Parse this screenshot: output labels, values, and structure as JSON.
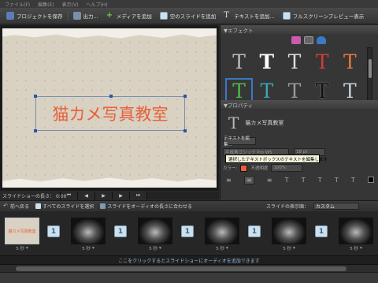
{
  "menubar": {
    "items": [
      "ファイル(F)",
      "編集(E)",
      "表示(V)",
      "ヘルプ(H)"
    ]
  },
  "toolbar": {
    "save_project": "プロジェクトを保存",
    "output": "出力...",
    "add_media": "メディアを追加",
    "add_blank_slide": "空のスライドを追加",
    "add_text": "テキストを追加...",
    "fullscreen_preview": "フルスクリーンプレビュー表示"
  },
  "preview": {
    "title_text": "猫カメ写真教室"
  },
  "transport": {
    "label": "スライドショーの長さ：",
    "time": "0:00"
  },
  "effects": {
    "header": "▼エフェクト"
  },
  "properties": {
    "header": "▼プロパティ",
    "text_name": "猫カメ写真教室",
    "edit_text_button": "テキストを編集...",
    "font": "平成角ゴシック Pro W5",
    "size": "18 pt",
    "color_label": "カラー:",
    "opacity": "不透明度",
    "opacity_value": "100%",
    "tooltip": "選択したテキストボックスのテキストを編集します"
  },
  "strip": {
    "back": "前へ戻る",
    "select_all": "すべてのスライドを選択",
    "fit_audio": "スライドをオーディオの長さに合わせる",
    "display_label": "スライドの表示順：",
    "display_value": "カスタム",
    "first_thumb_text": "猫カメ写真教室",
    "slot_label": "5 秒",
    "transition_label": "1"
  },
  "audio_bar": {
    "text": "ここをクリックするとスライドショーにオーディオを追加できます"
  },
  "colors": {
    "accent_text": "#e8603a",
    "selection_blue": "#3a78c8"
  }
}
